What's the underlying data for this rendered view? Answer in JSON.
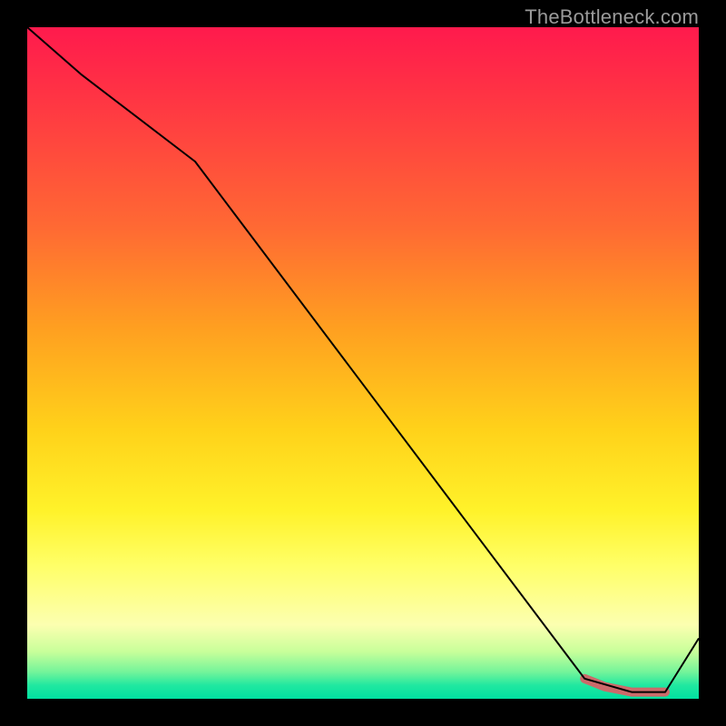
{
  "watermark": "TheBottleneck.com",
  "chart_data": {
    "type": "line",
    "title": "",
    "xlabel": "",
    "ylabel": "",
    "xlim": [
      0,
      100
    ],
    "ylim": [
      0,
      100
    ],
    "grid": false,
    "legend": false,
    "background_gradient": {
      "orientation": "vertical",
      "stops": [
        {
          "pos": 0.0,
          "color": "#ff1a4d"
        },
        {
          "pos": 0.3,
          "color": "#ff6a33"
        },
        {
          "pos": 0.6,
          "color": "#ffd21a"
        },
        {
          "pos": 0.8,
          "color": "#ffff66"
        },
        {
          "pos": 0.93,
          "color": "#c8ff9a"
        },
        {
          "pos": 1.0,
          "color": "#00e0a0"
        }
      ]
    },
    "series": [
      {
        "name": "main-line",
        "color": "#000000",
        "stroke_width": 2,
        "x": [
          0,
          8,
          25,
          83,
          90,
          95,
          100
        ],
        "values": [
          100,
          93,
          80,
          3,
          1,
          1,
          9
        ]
      },
      {
        "name": "highlight-segment",
        "color": "#cc6a6a",
        "stroke_width": 10,
        "linecap": "round",
        "x": [
          83,
          86,
          90,
          93,
          95
        ],
        "values": [
          3,
          1.8,
          1,
          1,
          1
        ]
      }
    ]
  }
}
